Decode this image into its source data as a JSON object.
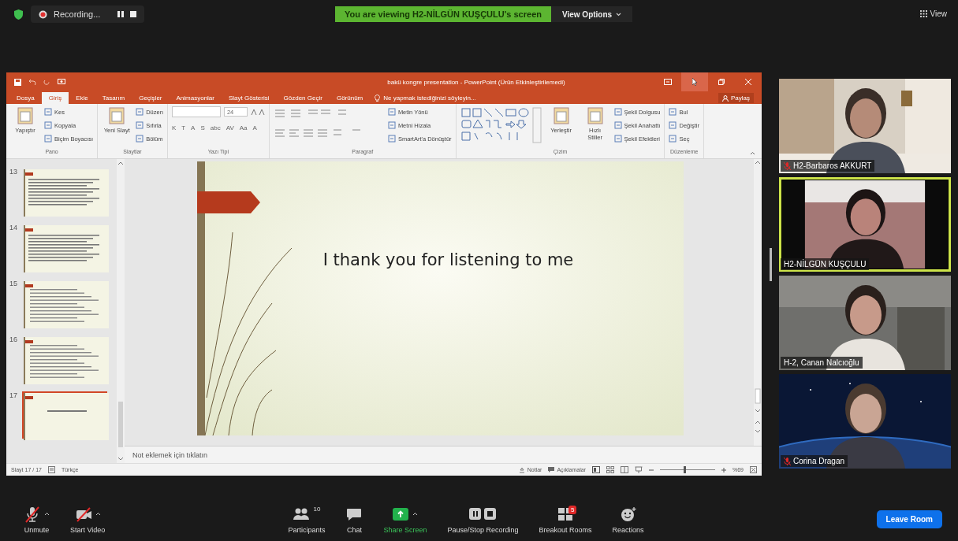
{
  "top_bar": {
    "recording_label": "Recording...",
    "banner": "You are viewing H2-NİLGÜN KUŞÇULU's screen",
    "view_options": "View Options",
    "view_button": "View"
  },
  "shared_screen": {
    "window_title": "bakü kongre presentation - PowerPoint (Ürün Etkinleştirilemedi)",
    "tabs": [
      {
        "label": "Dosya",
        "selected": false
      },
      {
        "label": "Giriş",
        "selected": true
      },
      {
        "label": "Ekle",
        "selected": false
      },
      {
        "label": "Tasarım",
        "selected": false
      },
      {
        "label": "Geçişler",
        "selected": false
      },
      {
        "label": "Animasyonlar",
        "selected": false
      },
      {
        "label": "Slayt Gösterisi",
        "selected": false
      },
      {
        "label": "Gözden Geçir",
        "selected": false
      },
      {
        "label": "Görünüm",
        "selected": false
      }
    ],
    "tell_me": "Ne yapmak istediğinizi söyleyin...",
    "share": "Paylaş",
    "ribbon_groups": [
      {
        "label": "Pano",
        "columns": [
          [
            {
              "kind": "large",
              "label": "Yapıştır"
            }
          ],
          [
            {
              "kind": "small",
              "label": "Kes"
            },
            {
              "kind": "small",
              "label": "Kopyala"
            },
            {
              "kind": "small",
              "label": "Biçim Boyacısı"
            }
          ]
        ]
      },
      {
        "label": "Slaytlar",
        "columns": [
          [
            {
              "kind": "large",
              "label": "Yeni Slayt"
            }
          ],
          [
            {
              "kind": "small",
              "label": "Düzen"
            },
            {
              "kind": "small",
              "label": "Sıfırla"
            },
            {
              "kind": "small",
              "label": "Bölüm"
            }
          ]
        ]
      },
      {
        "label": "Yazı Tipi",
        "columns": [
          [
            {
              "kind": "size-field",
              "label": "24"
            },
            {
              "kind": "glyphs",
              "labels": [
                "K",
                "T",
                "A",
                "S",
                "abc",
                "AV",
                "Aa",
                "A"
              ]
            }
          ]
        ]
      },
      {
        "label": "Paragraf",
        "columns": [
          [
            {
              "kind": "paragraph-tools"
            }
          ],
          [
            {
              "kind": "small",
              "label": "Metin Yönü"
            },
            {
              "kind": "small",
              "label": "Metni Hizala"
            },
            {
              "kind": "small",
              "label": "SmartArt'a Dönüştür"
            }
          ]
        ]
      },
      {
        "label": "Çizim",
        "columns": [
          [
            {
              "kind": "shapes"
            }
          ],
          [
            {
              "kind": "large",
              "label": "Yerleştir"
            }
          ],
          [
            {
              "kind": "large",
              "label": "Hızlı Stiller"
            }
          ],
          [
            {
              "kind": "small",
              "label": "Şekil Dolgusu"
            },
            {
              "kind": "small",
              "label": "Şekil Anahattı"
            },
            {
              "kind": "small",
              "label": "Şekil Efektleri"
            }
          ]
        ]
      },
      {
        "label": "Düzenleme",
        "columns": [
          [
            {
              "kind": "small",
              "label": "Bul"
            },
            {
              "kind": "small",
              "label": "Değiştir"
            },
            {
              "kind": "small",
              "label": "Seç"
            }
          ]
        ]
      }
    ],
    "thumbnails": [
      {
        "number": "13",
        "kind": "text",
        "selected": false
      },
      {
        "number": "14",
        "kind": "text",
        "selected": false
      },
      {
        "number": "15",
        "kind": "list",
        "selected": false
      },
      {
        "number": "16",
        "kind": "list",
        "selected": false
      },
      {
        "number": "17",
        "kind": "title",
        "selected": true
      }
    ],
    "slide_text": "I thank you for listening to me",
    "notes_placeholder": "Not eklemek için tıklatın",
    "status_bar": {
      "slide": "Slayt 17 / 17",
      "language": "Türkçe",
      "notes": "Notlar",
      "comments": "Açıklamalar",
      "zoom": "%69",
      "zoom_slider": {
        "level": 0.45
      }
    }
  },
  "video_tiles": [
    {
      "name": "H2-Barbaros AKKURT",
      "muted": true,
      "active_speaker": false
    },
    {
      "name": "H2-NİLGÜN KUŞÇULU",
      "muted": false,
      "active_speaker": true
    },
    {
      "name": "H-2, Canan Nalcıoğlu",
      "muted": false,
      "active_speaker": false
    },
    {
      "name": "Corina Dragan",
      "muted": true,
      "active_speaker": false
    }
  ],
  "toolbar": [
    {
      "kind": "mic",
      "label": "Unmute",
      "caret": true
    },
    {
      "kind": "video",
      "label": "Start Video",
      "caret": true
    },
    {
      "kind": "participants",
      "label": "Participants",
      "count": "10",
      "caret": false
    },
    {
      "kind": "chat",
      "label": "Chat",
      "caret": false
    },
    {
      "kind": "share",
      "label": "Share Screen",
      "caret": true
    },
    {
      "kind": "record",
      "label": "Pause/Stop Recording",
      "caret": false
    },
    {
      "kind": "breakout",
      "label": "Breakout Rooms",
      "badge": "5",
      "caret": false
    },
    {
      "kind": "reactions",
      "label": "Reactions",
      "caret": false
    }
  ],
  "leave_button": "Leave Room"
}
